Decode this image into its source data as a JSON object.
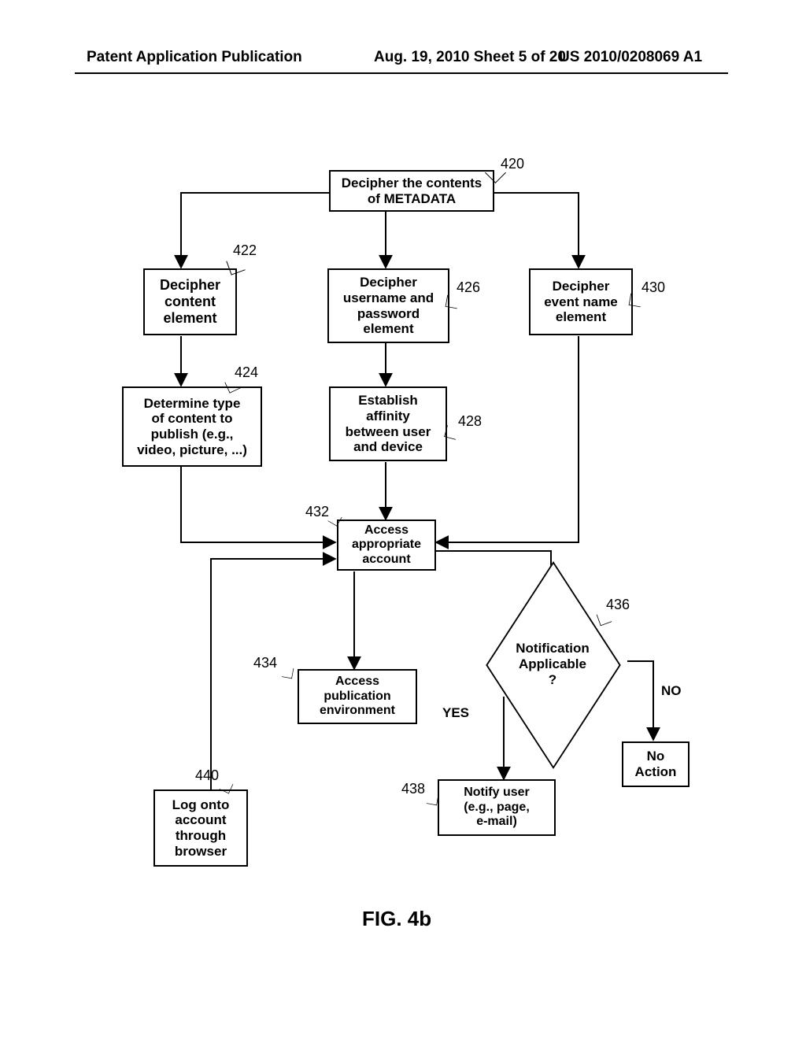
{
  "header": {
    "left": "Patent Application Publication",
    "mid": "Aug. 19, 2010  Sheet 5 of 20",
    "right": "US 2010/0208069 A1"
  },
  "figure_label": "FIG. 4b",
  "refs": {
    "r420": "420",
    "r422": "422",
    "r424": "424",
    "r426": "426",
    "r428": "428",
    "r430": "430",
    "r432": "432",
    "r434": "434",
    "r436": "436",
    "r438": "438",
    "r440": "440"
  },
  "nodes": {
    "n420": "Decipher the contents\nof METADATA",
    "n422": "Decipher\ncontent\nelement",
    "n426": "Decipher\nusername and\npassword\nelement",
    "n430": "Decipher\nevent name\nelement",
    "n424": "Determine type\nof content to\npublish (e.g.,\nvideo, picture, ...)",
    "n428": "Establish\naffinity\nbetween user\nand device",
    "n432": "Access\nappropriate\naccount",
    "n434": "Access\npublication\nenvironment",
    "n436": "Notification\nApplicable\n?",
    "n438": "Notify user\n(e.g., page,\ne-mail)",
    "n440": "Log onto\naccount\nthrough\nbrowser",
    "nNoAction": "No\nAction"
  },
  "labels": {
    "yes": "YES",
    "no": "NO"
  }
}
